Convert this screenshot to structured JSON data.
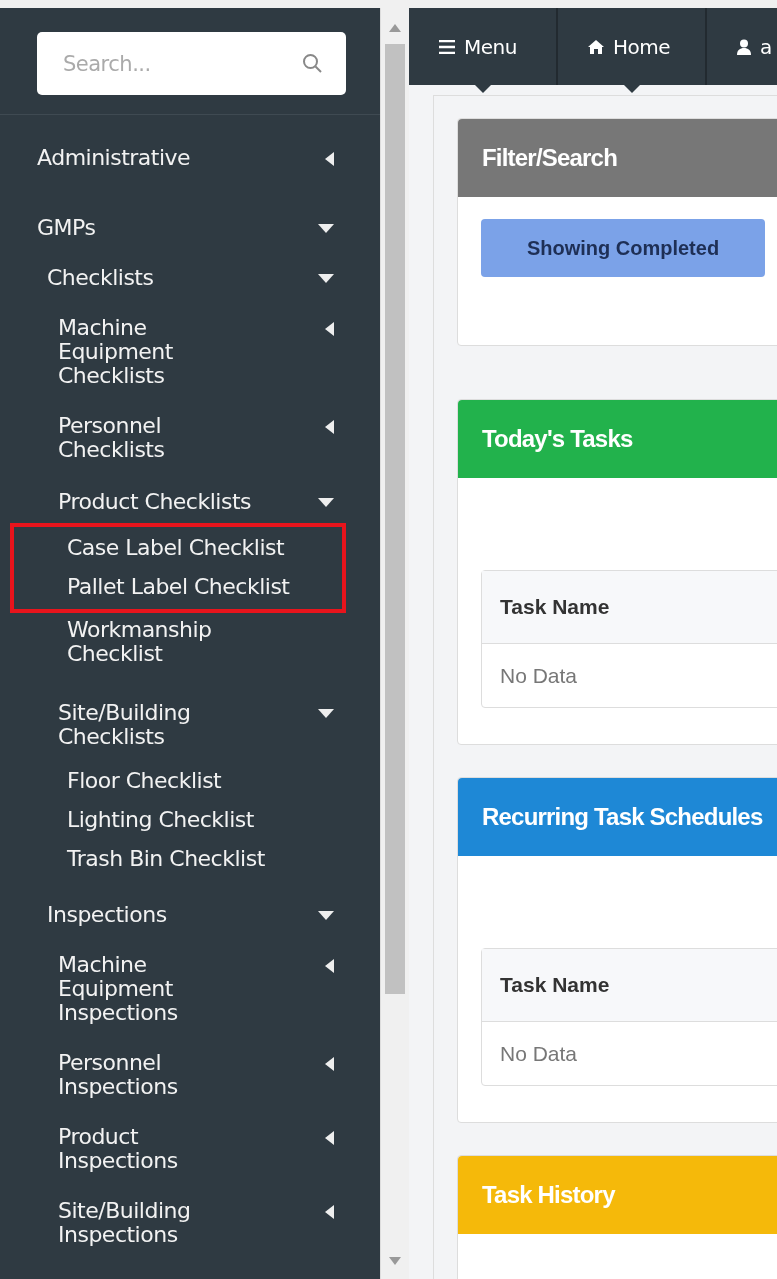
{
  "sidebar": {
    "search": {
      "placeholder": "Search..."
    },
    "items": [
      {
        "label": "Administrative",
        "expanded": false
      },
      {
        "label": "GMPs",
        "expanded": true,
        "children": [
          {
            "label": "Checklists",
            "expanded": true,
            "children": [
              {
                "label": "Machine\nEquipment\nChecklists",
                "expanded": false
              },
              {
                "label": "Personnel\nChecklists",
                "expanded": false
              },
              {
                "label": "Product Checklists",
                "expanded": true,
                "children": [
                  {
                    "label": "Case Label Checklist",
                    "highlighted": true
                  },
                  {
                    "label": "Pallet Label Checklist",
                    "highlighted": true
                  },
                  {
                    "label": "Workmanship\nChecklist",
                    "highlighted": false
                  }
                ]
              },
              {
                "label": "Site/Building\nChecklists",
                "expanded": true,
                "children": [
                  {
                    "label": "Floor Checklist",
                    "highlighted": false
                  },
                  {
                    "label": "Lighting Checklist",
                    "highlighted": false
                  },
                  {
                    "label": "Trash Bin Checklist",
                    "highlighted": false
                  }
                ]
              }
            ]
          },
          {
            "label": "Inspections",
            "expanded": true,
            "children": [
              {
                "label": "Machine\nEquipment\nInspections",
                "expanded": false
              },
              {
                "label": "Personnel\nInspections",
                "expanded": false
              },
              {
                "label": "Product\nInspections",
                "expanded": false
              },
              {
                "label": "Site/Building\nInspections",
                "expanded": false
              }
            ]
          }
        ]
      }
    ]
  },
  "topbar": {
    "tabs": [
      {
        "kind": "menu",
        "label": "Menu"
      },
      {
        "kind": "home",
        "label": "Home"
      },
      {
        "kind": "user",
        "label": "a"
      }
    ]
  },
  "panels": [
    {
      "title": "Filter/Search",
      "color": "#777777",
      "kind": "filter",
      "button": "Showing Completed"
    },
    {
      "title": "Today's Tasks",
      "color": "#22b24c",
      "kind": "table",
      "columns": [
        "Task Name"
      ],
      "empty": "No Data"
    },
    {
      "title": "Recurring Task Schedules",
      "color": "#1e88d6",
      "kind": "table",
      "columns": [
        "Task Name"
      ],
      "empty": "No Data"
    },
    {
      "title": "Task History",
      "color": "#f5b90a",
      "kind": "empty"
    }
  ]
}
